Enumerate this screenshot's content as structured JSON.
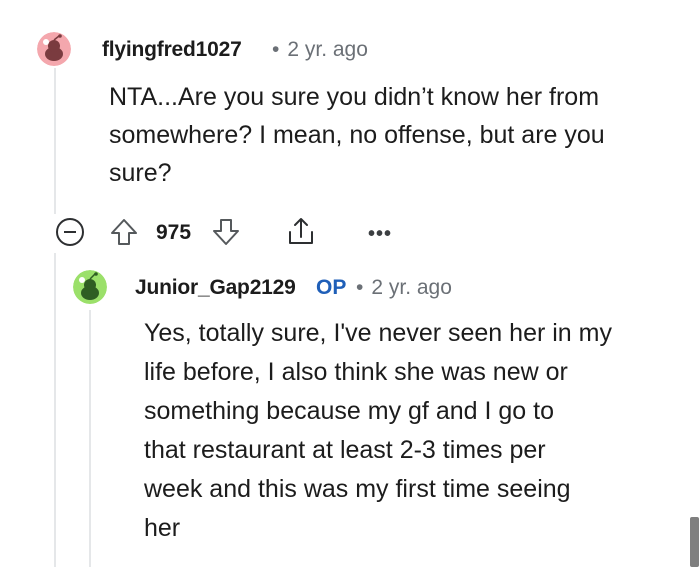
{
  "comments": [
    {
      "username": "flyingfred1027",
      "separator": "•",
      "timestamp": "2 yr. ago",
      "avatar_icon": "snoo-avatar-red",
      "body_lines": [
        "NTA...Are you sure you didn’t know her from",
        "somewhere? I mean, no offense, but are you",
        "sure?"
      ],
      "actions": {
        "collapse_icon": "collapse-minus-icon",
        "upvote_icon": "upvote-arrow-icon",
        "vote_count": "975",
        "downvote_icon": "downvote-arrow-icon",
        "share_icon": "share-icon",
        "more_label": "•••"
      }
    },
    {
      "username": "Junior_Gap2129",
      "op_badge": "OP",
      "separator": "•",
      "timestamp": "2 yr. ago",
      "avatar_icon": "snoo-avatar-green",
      "body_lines": [
        "Yes, totally sure, I've never seen her in my",
        "life before, I also think she was new or",
        "something because my gf and I go to",
        "that restaurant at least 2-3 times per",
        "week and this was my first time seeing",
        "her"
      ]
    }
  ],
  "colors": {
    "op_badge": "#1f5fb8",
    "meta_text": "#6b7076",
    "thread_line": "#e5e7e9",
    "avatar_red": "#f4a7ad",
    "avatar_green": "#9be06a"
  }
}
